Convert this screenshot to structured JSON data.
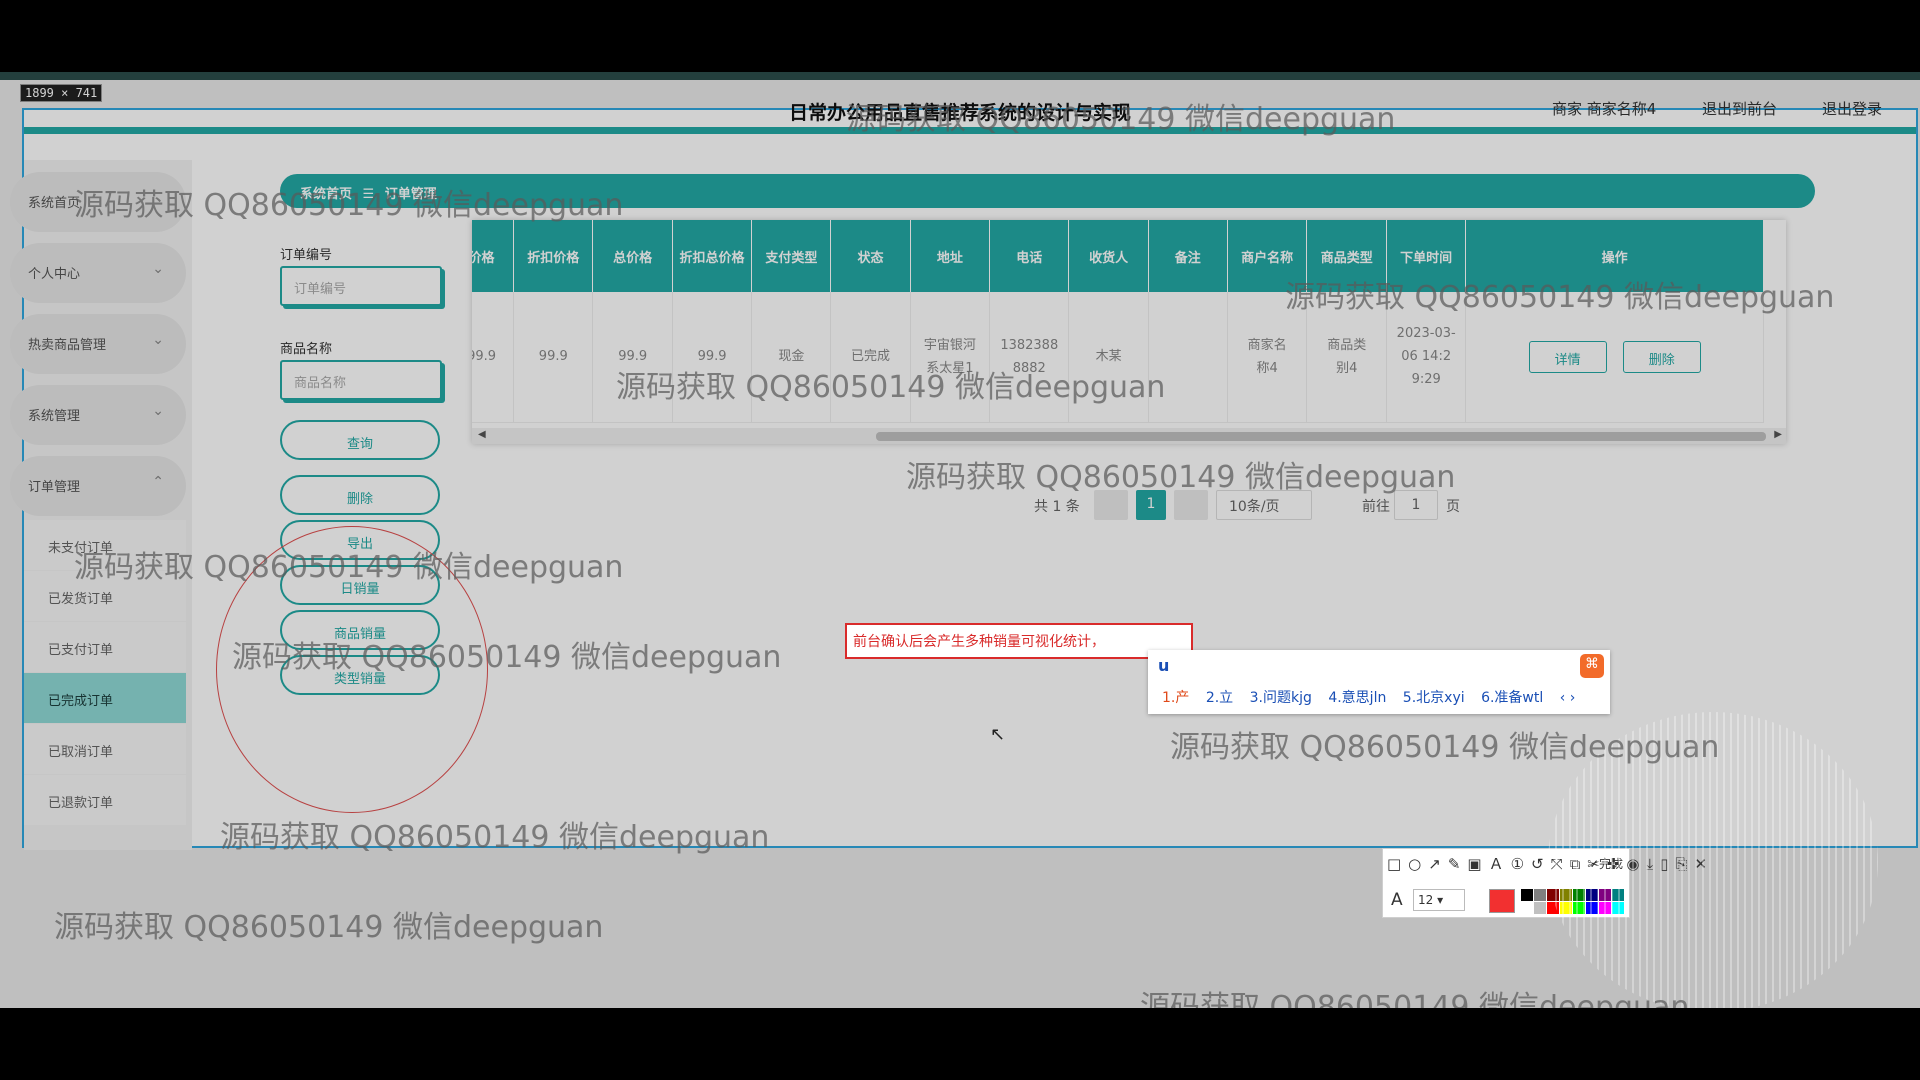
{
  "screen": {
    "size_badge": "1899 × 741"
  },
  "header": {
    "title": "日常办公用品直售推荐系统的设计与实现",
    "merchant_label": "商家 商家名称4",
    "to_front": "退出到前台",
    "logout": "退出登录"
  },
  "sidebar": {
    "items": [
      {
        "label": "系统首页",
        "chevron": ""
      },
      {
        "label": "个人中心",
        "chevron": "⌄"
      },
      {
        "label": "热卖商品管理",
        "chevron": "⌄"
      },
      {
        "label": "系统管理",
        "chevron": "⌄"
      },
      {
        "label": "订单管理",
        "chevron": "⌃"
      }
    ],
    "sub_items": [
      "未支付订单",
      "已发货订单",
      "已支付订单",
      "已完成订单",
      "已取消订单",
      "已退款订单"
    ],
    "active_sub": "已完成订单"
  },
  "breadcrumb": {
    "home": "系统首页",
    "sep": "☰",
    "current": "订单管理"
  },
  "filters": {
    "order_no_label": "订单编号",
    "order_no_placeholder": "订单编号",
    "product_name_label": "商品名称",
    "product_name_placeholder": "商品名称"
  },
  "buttons": {
    "query": "查询",
    "delete": "删除",
    "export": "导出",
    "daily_sales": "日销量",
    "product_sales": "商品销量",
    "type_sales": "类型销量"
  },
  "table": {
    "headers": [
      "价格",
      "折扣价格",
      "总价格",
      "折扣总价格",
      "支付类型",
      "状态",
      "地址",
      "电话",
      "收货人",
      "备注",
      "商户名称",
      "商品类型",
      "下单时间",
      "操作"
    ],
    "row": {
      "price": "99.9",
      "discount_price": "99.9",
      "total": "99.9",
      "discount_total": "99.9",
      "pay_type": "现金",
      "status": "已完成",
      "address": "宇宙银河系太星1",
      "phone": "13823888882",
      "receiver": "木某",
      "note": "",
      "merchant": "商家名称4",
      "product_type": "商品类别4",
      "order_time": "2023-03-06 14:29:29",
      "detail_btn": "详情",
      "delete_btn": "删除"
    }
  },
  "pagination": {
    "total": "共 1 条",
    "page_size": "10条/页",
    "current_page": "1",
    "goto_prefix": "前往",
    "goto_value": "1",
    "goto_suffix": "页"
  },
  "annotation": {
    "text": "前台确认后会产生多种销量可视化统计，"
  },
  "ime": {
    "input": "u",
    "candidates": [
      "1.产",
      "2.立",
      "3.问题kjg",
      "4.意思jln",
      "5.北京xyi",
      "6.准备wtl"
    ]
  },
  "toolbar": {
    "icons": "□○↗✎▣Ａ①↺⤧⧉✂✜◉⤓▯⎘✕",
    "done": "✓完成",
    "font_size": "12",
    "colors": [
      "#000000",
      "#808080",
      "#800000",
      "#808000",
      "#008000",
      "#000080",
      "#800080",
      "#008080",
      "#ffffff",
      "#c0c0c0",
      "#ff0000",
      "#ffff00",
      "#00ff00",
      "#0000ff",
      "#ff00ff",
      "#00ffff"
    ],
    "selected_color": "#f23030"
  },
  "watermark": "源码获取 QQ86050149 微信deepguan"
}
